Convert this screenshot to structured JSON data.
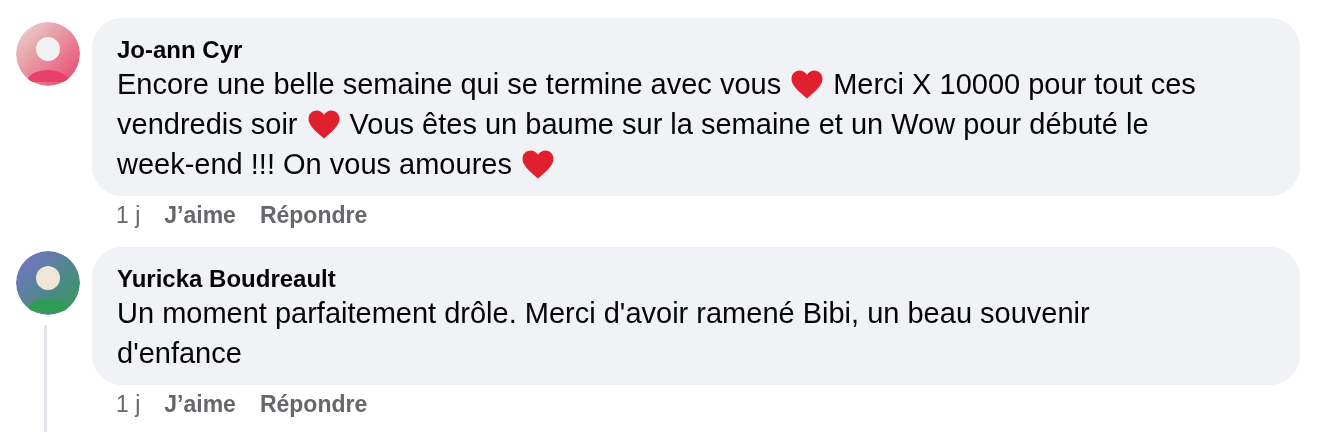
{
  "comments": [
    {
      "author": "Jo-ann Cyr",
      "lines": [
        [
          {
            "kind": "text",
            "text": "Encore une belle semaine qui se termine avec vous"
          },
          {
            "kind": "heart"
          },
          {
            "kind": "text",
            "text": "Merci X 10000 pour tout ces"
          }
        ],
        [
          {
            "kind": "text",
            "text": "vendredis soir"
          },
          {
            "kind": "heart"
          },
          {
            "kind": "text",
            "text": "Vous êtes un baume sur la semaine et un Wow pour débuté le"
          }
        ],
        [
          {
            "kind": "text",
            "text": "week-end !!! On vous amoures"
          },
          {
            "kind": "heart"
          }
        ]
      ],
      "time": "1 j",
      "like": "J’aime",
      "reply": "Répondre",
      "thread_line": false
    },
    {
      "author": "Yuricka Boudreault",
      "lines": [
        [
          {
            "kind": "text",
            "text": "Un moment parfaitement drôle. Merci d'avoir ramené Bibi, un beau souvenir"
          }
        ],
        [
          {
            "kind": "text",
            "text": "d'enfance"
          }
        ]
      ],
      "time": "1 j",
      "like": "J’aime",
      "reply": "Répondre",
      "thread_line": true
    }
  ]
}
